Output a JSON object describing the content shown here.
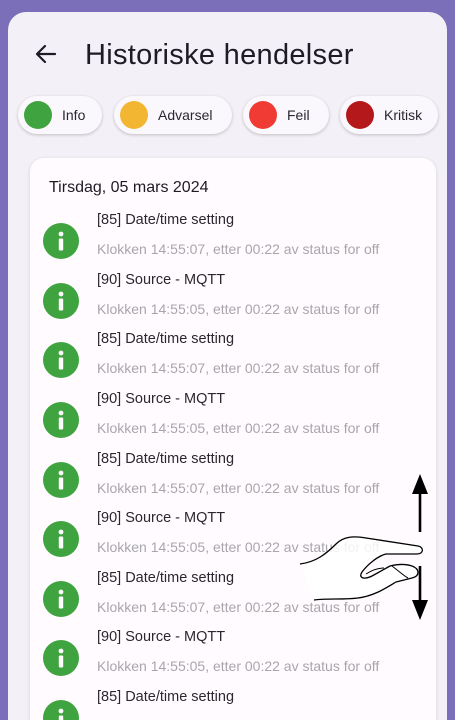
{
  "header": {
    "title": "Historiske hendelser"
  },
  "filters": [
    {
      "label": "Info",
      "color": "#3fa33f"
    },
    {
      "label": "Advarsel",
      "color": "#f2b632"
    },
    {
      "label": "Feil",
      "color": "#ef3b33"
    },
    {
      "label": "Kritisk",
      "color": "#b5181b"
    }
  ],
  "events": {
    "date": "Tirsdag, 05 mars 2024",
    "items": [
      {
        "title": "[85] Date/time setting",
        "detail": "Klokken 14:55:07, etter 00:22 av status for off",
        "level": "info"
      },
      {
        "title": "[90] Source - MQTT",
        "detail": "Klokken 14:55:05, etter 00:22 av status for off",
        "level": "info"
      },
      {
        "title": "[85] Date/time setting",
        "detail": "Klokken 14:55:07, etter 00:22 av status for off",
        "level": "info"
      },
      {
        "title": "[90] Source - MQTT",
        "detail": "Klokken 14:55:05, etter 00:22 av status for off",
        "level": "info"
      },
      {
        "title": "[85] Date/time setting",
        "detail": "Klokken 14:55:07, etter 00:22 av status for off",
        "level": "info"
      },
      {
        "title": "[90] Source - MQTT",
        "detail": "Klokken 14:55:05, etter 00:22 av status for off",
        "level": "info"
      },
      {
        "title": "[85] Date/time setting",
        "detail": "Klokken 14:55:07, etter 00:22 av status for off",
        "level": "info"
      },
      {
        "title": "[90] Source - MQTT",
        "detail": "Klokken 14:55:05, etter 00:22 av status for off",
        "level": "info"
      },
      {
        "title": "[85] Date/time setting",
        "detail": "",
        "level": "info"
      }
    ]
  },
  "icons": {
    "back": "arrow-left-icon",
    "event": "info-icon",
    "overlay": "swipe-vertical-gesture-icon"
  }
}
